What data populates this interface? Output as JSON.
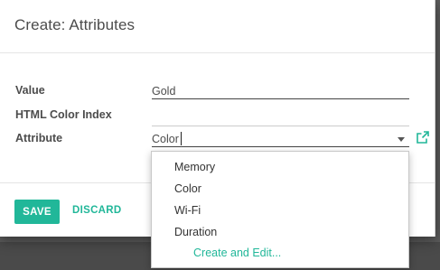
{
  "dialog": {
    "title": "Create: Attributes"
  },
  "form": {
    "value_label": "Value",
    "value": "Gold",
    "color_index_label": "HTML Color Index",
    "attribute_label": "Attribute",
    "attribute_value": "Color"
  },
  "dropdown": {
    "options": [
      "Memory",
      "Color",
      "Wi-Fi",
      "Duration"
    ],
    "create_label": "Create and Edit..."
  },
  "footer": {
    "save_label": "SAVE",
    "discard_label": "DISCARD"
  },
  "colors": {
    "accent": "#21b799",
    "text": "#4c4c4c",
    "overlay": "#5c5c5c"
  },
  "icons": {
    "dropdown": "caret-down-icon",
    "external": "external-link-icon"
  }
}
